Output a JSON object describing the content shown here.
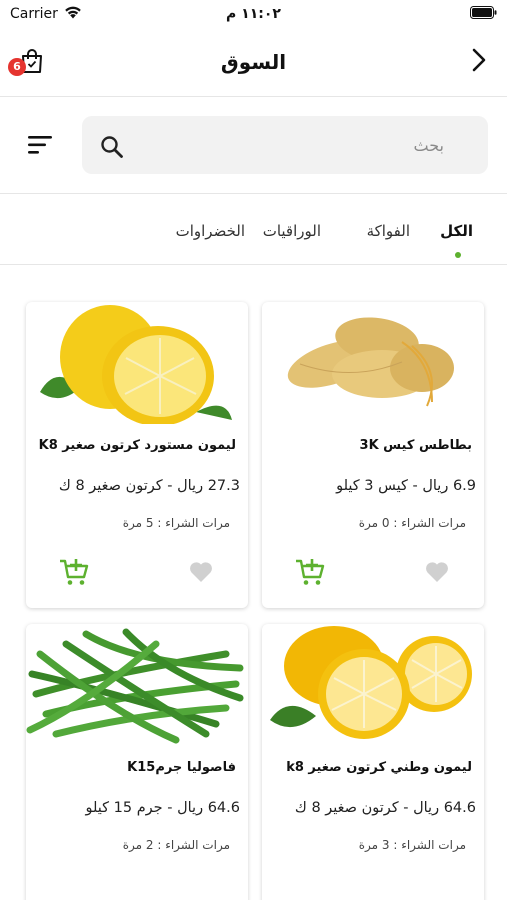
{
  "status_bar": {
    "carrier": "Carrier",
    "time": "١١:٠٢ م"
  },
  "nav": {
    "title": "السوق",
    "cart_count": "6"
  },
  "search": {
    "placeholder": "بحث"
  },
  "tabs": [
    {
      "label": "الكل",
      "active": true
    },
    {
      "label": "الفواكة",
      "active": false
    },
    {
      "label": "الوراقيات",
      "active": false
    },
    {
      "label": "الخضراوات",
      "active": false
    }
  ],
  "products": [
    {
      "name": "بطاطس كيس 3K",
      "price": "6.9 ريال - كيس 3 كيلو",
      "purchases": "مرات الشراء : 0 مرة",
      "image": "potatoes-image"
    },
    {
      "name": "ليمون مستورد كرتون صغير K8",
      "price": "27.3 ريال - كرتون صغير 8 ك",
      "purchases": "مرات الشراء : 5 مرة",
      "image": "imported-lemon-image"
    },
    {
      "name": "ليمون وطني كرتون صغير k8",
      "price": "64.6 ريال - كرتون صغير 8 ك",
      "purchases": "مرات الشراء : 3 مرة",
      "image": "local-lemon-image"
    },
    {
      "name": "فاصوليا جرمK15",
      "price": "64.6 ريال - جرم 15 كيلو",
      "purchases": "مرات الشراء : 2 مرة",
      "image": "green-beans-image"
    }
  ],
  "colors": {
    "accent_green": "#5db12f",
    "badge_red": "#e5342f",
    "heart_gray": "#d0d0d0"
  },
  "icons": [
    "wifi-icon",
    "battery-icon",
    "shopping-bag-icon",
    "chevron-right-icon",
    "filter-icon",
    "search-icon",
    "heart-icon",
    "add-to-cart-icon"
  ]
}
